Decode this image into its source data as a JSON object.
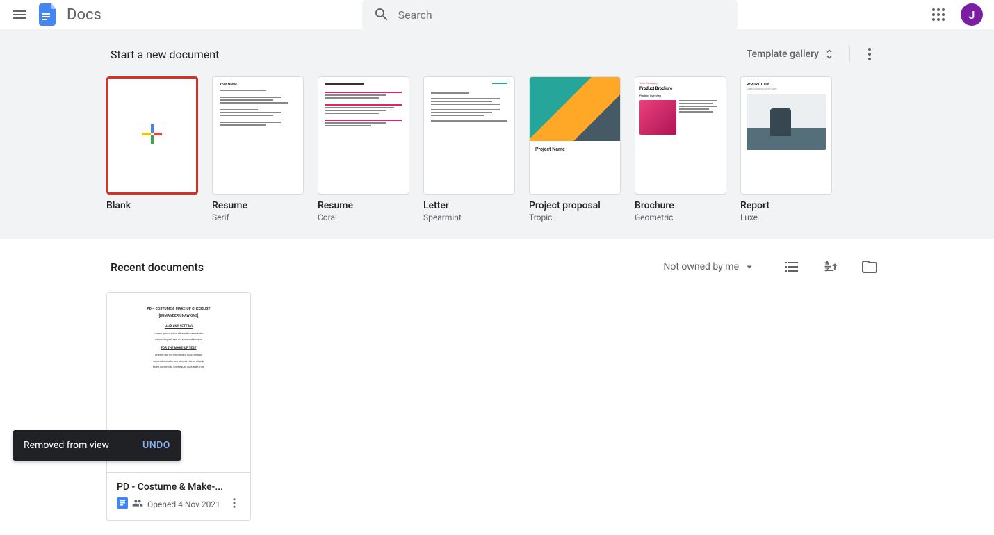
{
  "header": {
    "app_title": "Docs",
    "search_placeholder": "Search",
    "avatar_initial": "J"
  },
  "templates": {
    "section_title": "Start a new document",
    "gallery_label": "Template gallery",
    "items": [
      {
        "label": "Blank",
        "subtitle": ""
      },
      {
        "label": "Resume",
        "subtitle": "Serif"
      },
      {
        "label": "Resume",
        "subtitle": "Coral"
      },
      {
        "label": "Letter",
        "subtitle": "Spearmint"
      },
      {
        "label": "Project proposal",
        "subtitle": "Tropic"
      },
      {
        "label": "Brochure",
        "subtitle": "Geometric"
      },
      {
        "label": "Report",
        "subtitle": "Luxe"
      }
    ]
  },
  "recent": {
    "section_title": "Recent documents",
    "filter_label": "Not owned by me",
    "docs": [
      {
        "name": "PD - Costume & Make-...",
        "opened_prefix": "Opened",
        "opened_date": "4 Nov 2021"
      }
    ]
  },
  "toast": {
    "message": "Removed from view",
    "action": "UNDO"
  },
  "template_previews": {
    "resume_serif_name": "Your Name",
    "proposal_label": "Project Name",
    "brochure_company": "Your Company",
    "brochure_title": "Product Brochure",
    "brochure_overview": "Product Overview",
    "report_title": "REPORT TITLE",
    "report_sub": "LOREM IPSUM DOLOR SIT AMET"
  },
  "doc_preview": {
    "title": "PD – COSTUME & MAKE-UP CHECKLIST",
    "character": "[BUMANDER UNAWKINS]",
    "section1": "HAIR AND SETTING",
    "section2": "FOR THE MAKE-UP TEST"
  }
}
